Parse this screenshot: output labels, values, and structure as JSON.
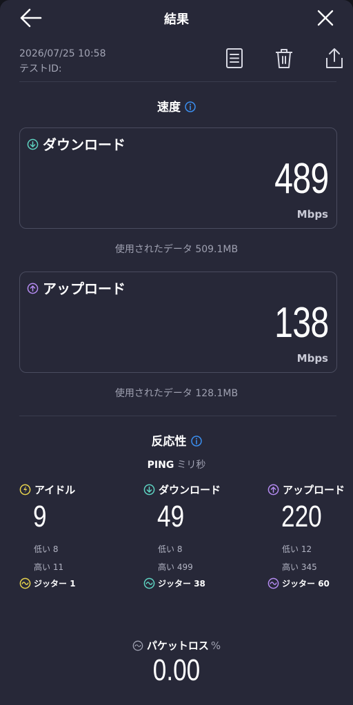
{
  "header": {
    "title": "結果",
    "back_icon": "arrow-left-icon",
    "close_icon": "close-icon"
  },
  "meta": {
    "date": "2026/07/25 10:58",
    "test_id": "テストID:"
  },
  "toolbar": [
    "document-icon",
    "trash-icon",
    "share-icon"
  ],
  "speed": {
    "title": "速度",
    "download": {
      "label": "ダウンロード",
      "value": "489",
      "unit": "Mbps",
      "used": "使用されたデータ 509.1MB"
    },
    "upload": {
      "label": "アップロード",
      "value": "138",
      "unit": "Mbps",
      "used": "使用されたデータ 128.1MB"
    }
  },
  "responsiveness": {
    "title": "反応性",
    "ping_label": "PING",
    "ping_unit": "ミリ秒",
    "idle": {
      "label": "アイドル",
      "value": "9",
      "low": "低い 8",
      "high": "高い 11",
      "jitter_label": "ジッター",
      "jitter": "1"
    },
    "download": {
      "label": "ダウンロード",
      "value": "49",
      "low": "低い 8",
      "high": "高い 499",
      "jitter_label": "ジッター",
      "jitter": "38"
    },
    "upload": {
      "label": "アップロード",
      "value": "220",
      "low": "低い 12",
      "high": "高い 345",
      "jitter_label": "ジッター",
      "jitter": "60"
    }
  },
  "packet_loss": {
    "label": "パケットロス",
    "unit": "%",
    "value": "0.00"
  },
  "colors": {
    "background": "#272838",
    "idle": "#e8d44d",
    "download": "#5ed4c2",
    "upload": "#b58bf2",
    "info": "#3b8ff0",
    "muted": "#9fa1b1"
  }
}
